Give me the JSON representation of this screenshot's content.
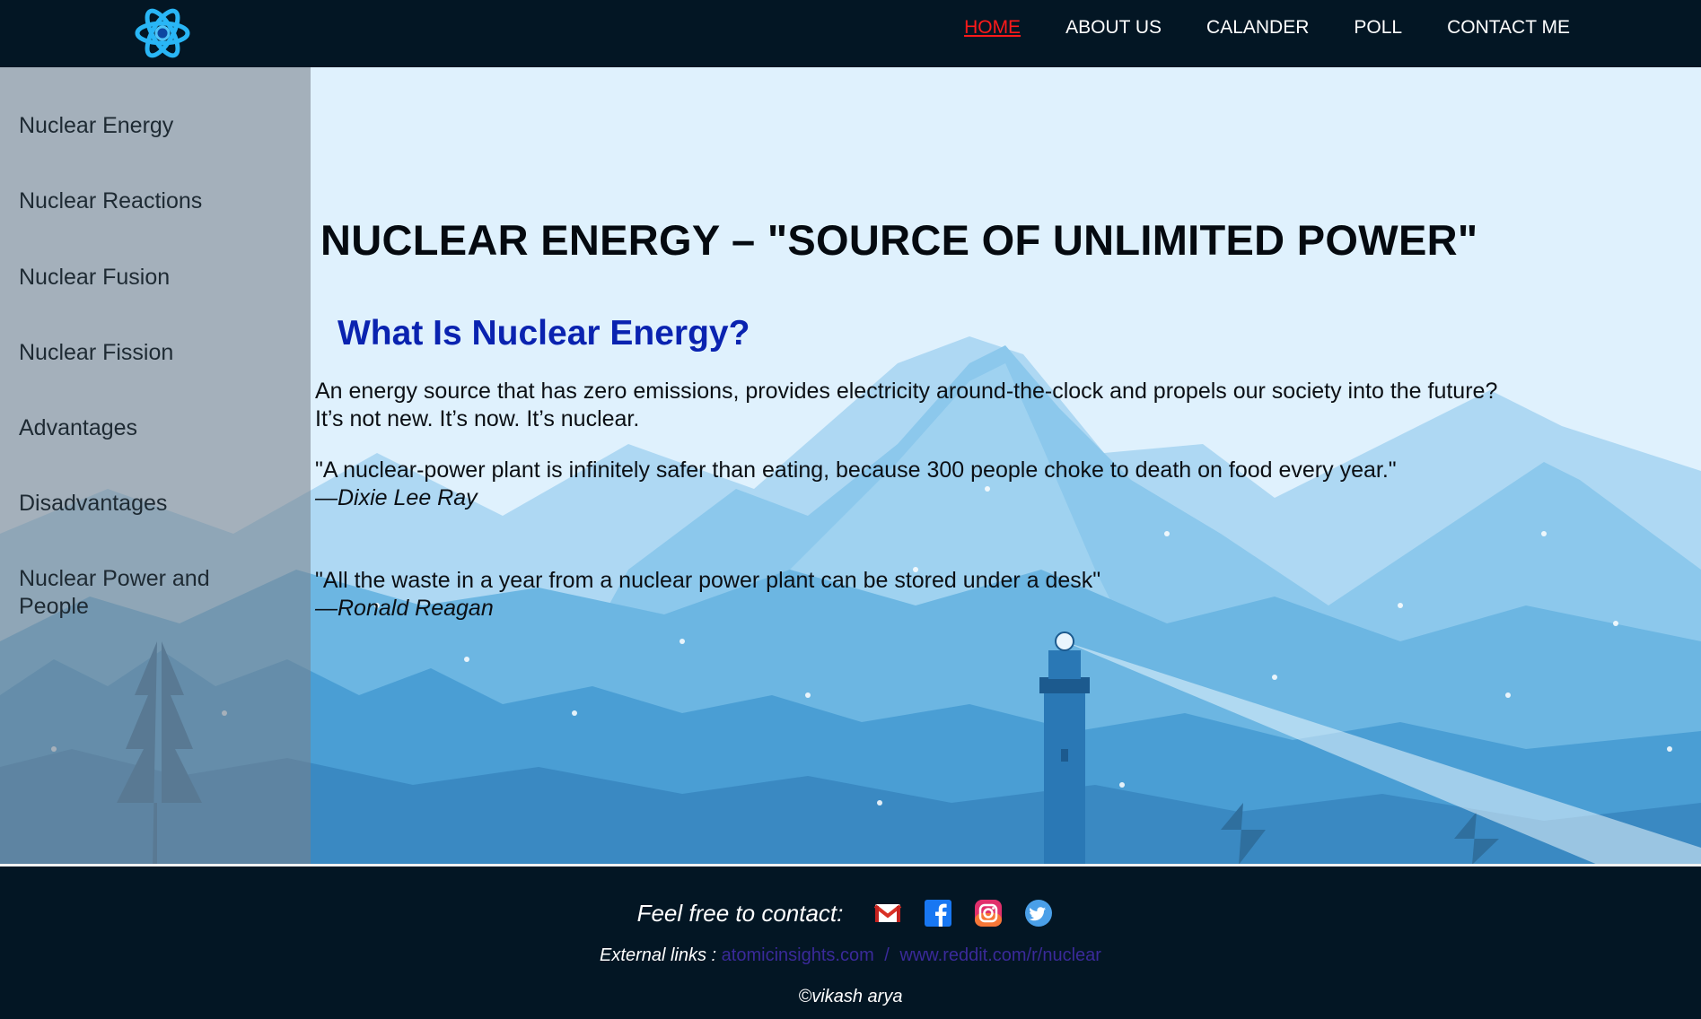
{
  "header": {
    "logo_icon": "atom-logo-icon",
    "nav": [
      {
        "label": "HOME",
        "active": true
      },
      {
        "label": "ABOUT US",
        "active": false
      },
      {
        "label": "CALANDER",
        "active": false
      },
      {
        "label": "POLL",
        "active": false
      },
      {
        "label": "CONTACT ME",
        "active": false
      }
    ]
  },
  "sidebar": {
    "items": [
      {
        "label": "Nuclear Energy"
      },
      {
        "label": "Nuclear Reactions"
      },
      {
        "label": "Nuclear Fusion"
      },
      {
        "label": "Nuclear Fission"
      },
      {
        "label": "Advantages"
      },
      {
        "label": "Disadvantages"
      },
      {
        "label": "Nuclear Power and People"
      }
    ]
  },
  "main": {
    "title": "NUCLEAR ENERGY – \"SOURCE OF UNLIMITED POWER\"",
    "subtitle": "What Is Nuclear Energy?",
    "intro_line1": "An energy source that has zero emissions, provides electricity around-the-clock and propels our society into the future?",
    "intro_line2": "It’s not new. It’s now. It’s nuclear.",
    "quotes": [
      {
        "text": "\"A nuclear-power plant is infinitely safer than eating, because 300 people choke to death on food every year.\"",
        "author": "—Dixie Lee Ray"
      },
      {
        "text": "\"All the waste in a year from a nuclear power plant can be stored under a desk\"",
        "author": "—Ronald Reagan"
      }
    ]
  },
  "footer": {
    "contact_label": "Feel free to contact:",
    "social_icons": [
      "gmail-icon",
      "facebook-icon",
      "instagram-icon",
      "twitter-icon"
    ],
    "external_label": "External links :",
    "links": [
      "atomicinsights.com",
      "www.reddit.com/r/nuclear"
    ],
    "link_separator": "/",
    "copyright": "©vikash arya"
  },
  "colors": {
    "header_bg": "#031624",
    "nav_active": "#ff1a1a",
    "subtitle": "#0a23b0",
    "link": "#3a2a9a"
  }
}
